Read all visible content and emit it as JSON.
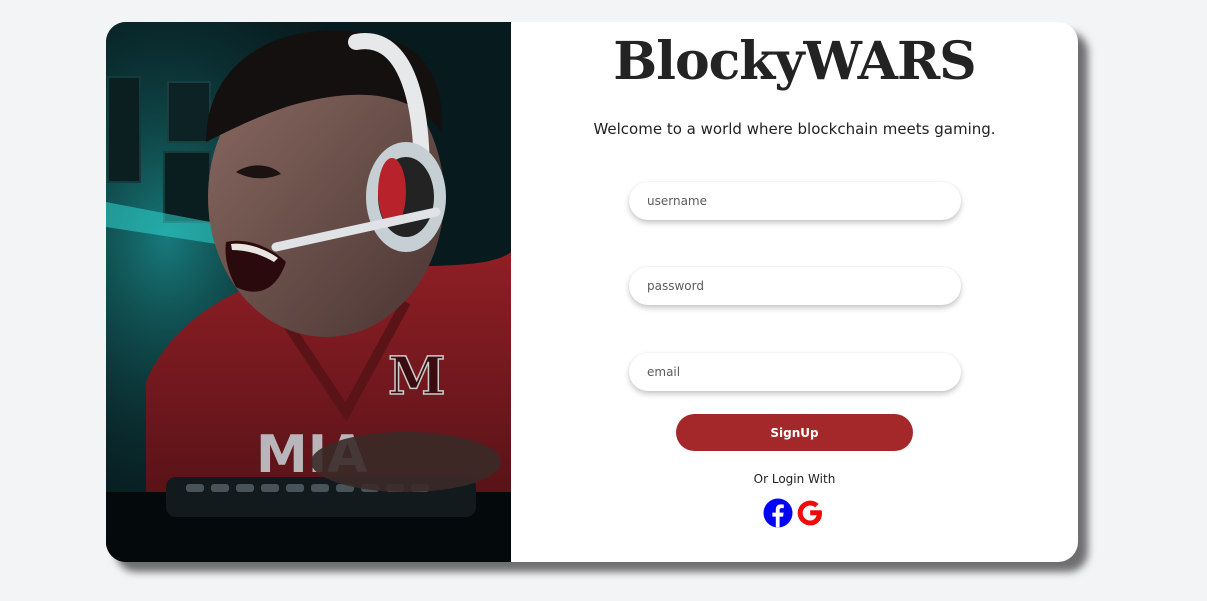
{
  "brand": {
    "title": "BlockyWARS"
  },
  "tagline": "Welcome to a world where blockchain meets gaming.",
  "form": {
    "username_placeholder": "username",
    "password_placeholder": "password",
    "email_placeholder": "email",
    "signup_label": "SignUp",
    "alt_login_label": "Or Login With"
  },
  "social": [
    {
      "name": "facebook-icon",
      "color": "#0404f4"
    },
    {
      "name": "google-icon",
      "color": "#f00a0a"
    }
  ],
  "colors": {
    "signup_button": "#a4282a",
    "page_background": "#f3f4f6",
    "card_background": "#ffffff"
  }
}
